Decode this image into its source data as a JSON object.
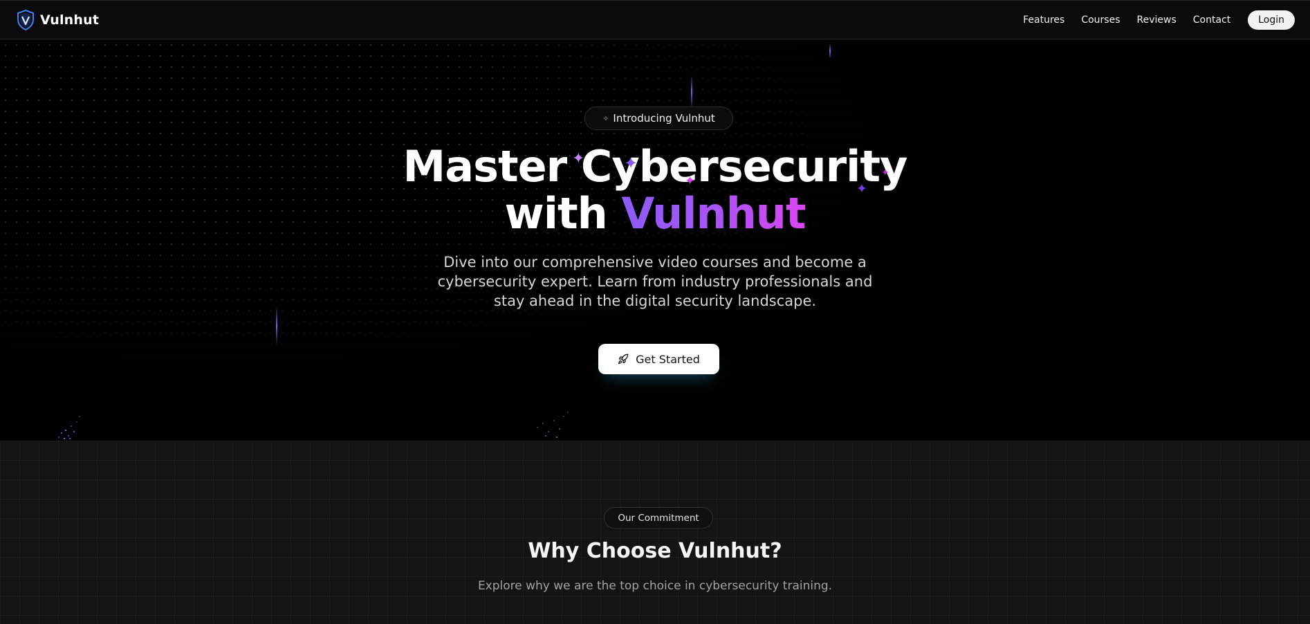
{
  "nav": {
    "brand": "Vulnhut",
    "links": [
      "Features",
      "Courses",
      "Reviews",
      "Contact"
    ],
    "login_label": "Login"
  },
  "hero": {
    "pill_icon": "sparkles-icon",
    "pill_label": "Introducing Vulnhut",
    "title_line1": "Master Cybersecurity",
    "title_line2_prefix": "with",
    "title_line2_accent": "Vulnhut",
    "subtitle": "Dive into our comprehensive video courses and become a cybersecurity expert. Learn from industry professionals and stay ahead in the digital security landscape.",
    "cta_icon": "rocket-icon",
    "cta_label": "Get Started"
  },
  "commitment": {
    "pill_label": "Our Commitment",
    "title": "Why Choose Vulnhut?",
    "subtitle": "Explore why we are the top choice in cybersecurity training."
  },
  "colors": {
    "accent_start": "#8b5cf6",
    "accent_end": "#d946ef",
    "logo_blue": "#3b82f6",
    "background": "#000000",
    "section_background": "#141415"
  }
}
